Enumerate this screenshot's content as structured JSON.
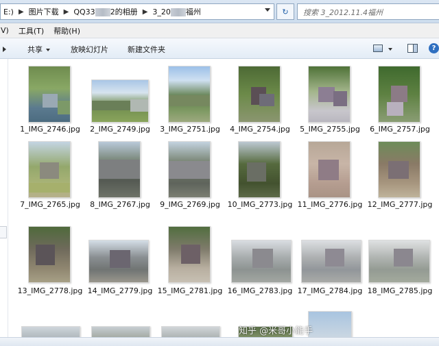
{
  "address_bar": {
    "crumbs": [
      "E:)",
      "图片下载",
      "QQ33",
      "2的相册",
      "3_20",
      "福州"
    ],
    "search_placeholder": "搜索 3_2012.11.4福州"
  },
  "menu": [
    "V)",
    "工具(T)",
    "帮助(H)"
  ],
  "toolbar": {
    "share_label": "共享",
    "slideshow_label": "放映幻灯片",
    "new_folder_label": "新建文件夹"
  },
  "files": [
    {
      "name": "1_IMG_2746.jpg"
    },
    {
      "name": "2_IMG_2749.jpg"
    },
    {
      "name": "3_IMG_2751.jpg"
    },
    {
      "name": "4_IMG_2754.jpg"
    },
    {
      "name": "5_IMG_2755.jpg"
    },
    {
      "name": "6_IMG_2757.jpg"
    },
    {
      "name": "7_IMG_2765.jpg"
    },
    {
      "name": "8_IMG_2767.jpg"
    },
    {
      "name": "9_IMG_2769.jpg"
    },
    {
      "name": "10_IMG_2773.jpg"
    },
    {
      "name": "11_IMG_2776.jpg"
    },
    {
      "name": "12_IMG_2777.jpg"
    },
    {
      "name": "13_IMG_2778.jpg"
    },
    {
      "name": "14_IMG_2779.jpg"
    },
    {
      "name": "15_IMG_2781.jpg"
    },
    {
      "name": "16_IMG_2783.jpg"
    },
    {
      "name": "17_IMG_2784.jpg"
    },
    {
      "name": "18_IMG_2785.jpg"
    }
  ],
  "watermark_text": "知乎 @米哥小能手",
  "colors": {
    "address_bg": "#d5e2f0",
    "selection_blue": "#2f6fc0",
    "file_text": "#111111"
  }
}
